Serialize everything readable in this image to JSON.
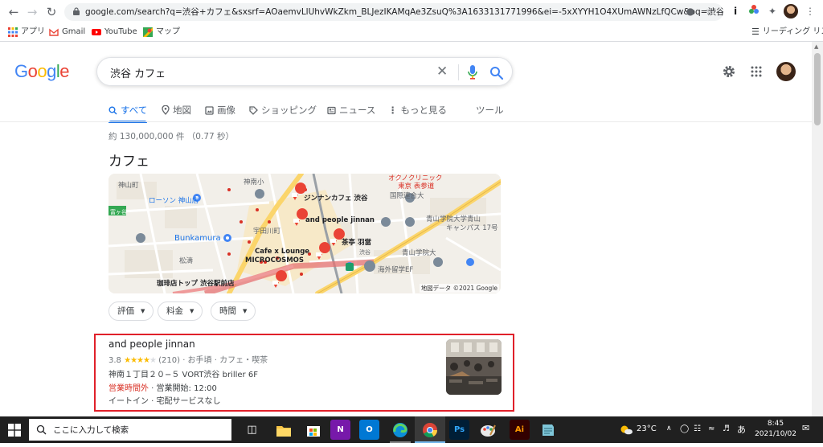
{
  "browser": {
    "url": "google.com/search?q=渋谷+カフェ&sxsrf=AOaemvLlUhvWkZkm_BLJezIKAMqAe3ZsuQ%3A1633131771996&ei=-5xXYYH1O4XUmAWNzLfQCw&oq=渋谷+カフ...",
    "bookmarks": [
      {
        "label": "アプリ",
        "icon": "apps-grid-icon"
      },
      {
        "label": "Gmail",
        "icon": "gmail-icon"
      },
      {
        "label": "YouTube",
        "icon": "youtube-icon"
      },
      {
        "label": "マップ",
        "icon": "maps-icon"
      }
    ],
    "reading_list": "リーディング リスト"
  },
  "search": {
    "query": "渋谷 カフェ",
    "logo_letters": [
      {
        "char": "G",
        "color": "#4285f4"
      },
      {
        "char": "o",
        "color": "#ea4335"
      },
      {
        "char": "o",
        "color": "#fbbc05"
      },
      {
        "char": "g",
        "color": "#4285f4"
      },
      {
        "char": "l",
        "color": "#34a853"
      },
      {
        "char": "e",
        "color": "#ea4335"
      }
    ]
  },
  "tabs": [
    {
      "label": "すべて",
      "icon": "search-icon",
      "active": true
    },
    {
      "label": "地図",
      "icon": "map-pin-icon"
    },
    {
      "label": "画像",
      "icon": "image-icon"
    },
    {
      "label": "ショッピング",
      "icon": "tag-icon"
    },
    {
      "label": "ニュース",
      "icon": "news-icon"
    },
    {
      "label": "もっと見る",
      "icon": "more-vert-icon"
    },
    {
      "label": "ツール"
    }
  ],
  "results": {
    "stats": "約 130,000,000 件 （0.77 秒）",
    "section_title": "カフェ"
  },
  "map": {
    "labels": [
      {
        "text": "神山町",
        "color": "#5f6368"
      },
      {
        "text": "神南小",
        "color": "#5f6368"
      },
      {
        "text": "オクノクリニック",
        "color": "#d93025"
      },
      {
        "text": "東京 表参道",
        "color": "#d93025"
      },
      {
        "text": "ローソン 神山店",
        "color": "#1a73e8"
      },
      {
        "text": "ジンナンカフェ 渋谷",
        "color": "#202124"
      },
      {
        "text": "国際連合大",
        "color": "#5f6368"
      },
      {
        "text": "and people jinnan",
        "color": "#202124"
      },
      {
        "text": "青山学院大学青山",
        "color": "#5f6368"
      },
      {
        "text": "キャンパス 17号",
        "color": "#5f6368"
      },
      {
        "text": "宇田川町",
        "color": "#5f6368"
      },
      {
        "text": "Bunkamura",
        "color": "#1a73e8"
      },
      {
        "text": "茶亭 羽當",
        "color": "#202124"
      },
      {
        "text": "Cafe x Lounge",
        "color": "#202124"
      },
      {
        "text": "MICROCOSMOS",
        "color": "#202124"
      },
      {
        "text": "松濤",
        "color": "#5f6368"
      },
      {
        "text": "青山学院大",
        "color": "#5f6368"
      },
      {
        "text": "海外留学EF",
        "color": "#5f6368"
      },
      {
        "text": "珈琲店トップ 渋谷駅前店",
        "color": "#202124"
      },
      {
        "text": "富ヶ谷",
        "color": "#ffffff"
      },
      {
        "text": "渋谷",
        "color": "#5f6368"
      }
    ],
    "attribution": "地図データ ©2021 Google"
  },
  "filters": [
    {
      "label": "評価"
    },
    {
      "label": "料金"
    },
    {
      "label": "時間"
    }
  ],
  "listing": {
    "name": "and people jinnan",
    "rating": "3.8",
    "stars_filled": 4,
    "stars_total": 5,
    "review_info": "(210) · お手頃 · カフェ・喫茶",
    "address": "神南１丁目２０−５ VORT渋谷 briller 6F",
    "status": "営業時間外",
    "hours": " · 営業開始: 12:00",
    "services": "イートイン · 宅配サービスなし",
    "highlight_color": "#e0202a"
  },
  "taskbar": {
    "search_placeholder": "ここに入力して検索",
    "apps": [
      {
        "icon": "task-view-icon",
        "label": ""
      },
      {
        "icon": "file-explorer-icon",
        "label": ""
      },
      {
        "icon": "store-icon",
        "label": ""
      },
      {
        "icon": "onenote-icon",
        "label": "N"
      },
      {
        "icon": "outlook-icon",
        "label": "O"
      },
      {
        "icon": "edge-icon",
        "label": ""
      },
      {
        "icon": "chrome-icon",
        "label": ""
      },
      {
        "icon": "photoshop-icon",
        "label": "Ps"
      },
      {
        "icon": "paint-icon",
        "label": ""
      },
      {
        "icon": "illustrator-icon",
        "label": "Ai"
      },
      {
        "icon": "notepad-icon",
        "label": ""
      }
    ],
    "weather": "23°C",
    "ime": "あ",
    "time": "8:45",
    "date": "2021/10/02"
  }
}
